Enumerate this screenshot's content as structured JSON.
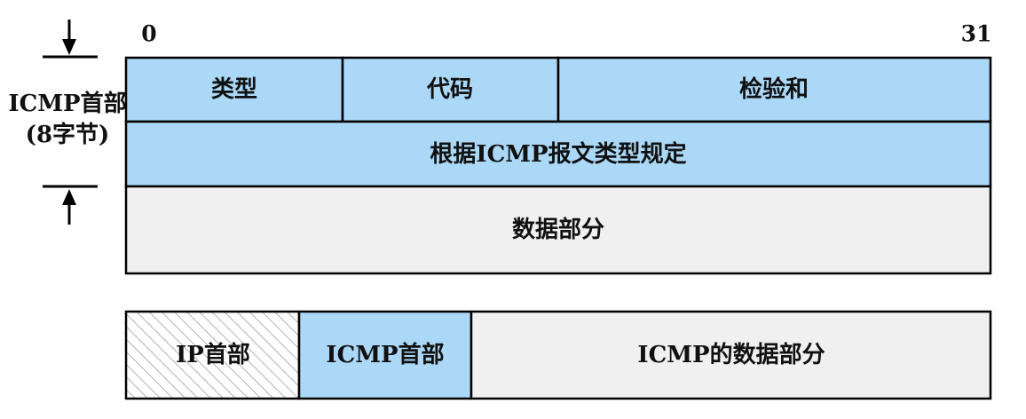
{
  "bit_labels": {
    "start": "0",
    "end": "31"
  },
  "header_label": {
    "line1": "ICMP首部",
    "line2": "(8字节)"
  },
  "icmp_header": {
    "row1": [
      {
        "label": "类型"
      },
      {
        "label": "代码"
      },
      {
        "label": "检验和"
      }
    ],
    "row2": "根据ICMP报文类型规定",
    "data": "数据部分"
  },
  "packet": {
    "ip_header": "IP首部",
    "icmp_header": "ICMP首部",
    "icmp_data": "ICMP的数据部分"
  },
  "colors": {
    "header_fill": "#aad8f6",
    "data_fill": "#f0f0f0",
    "hatch": "#9a9a9a",
    "stroke": "#000000"
  }
}
